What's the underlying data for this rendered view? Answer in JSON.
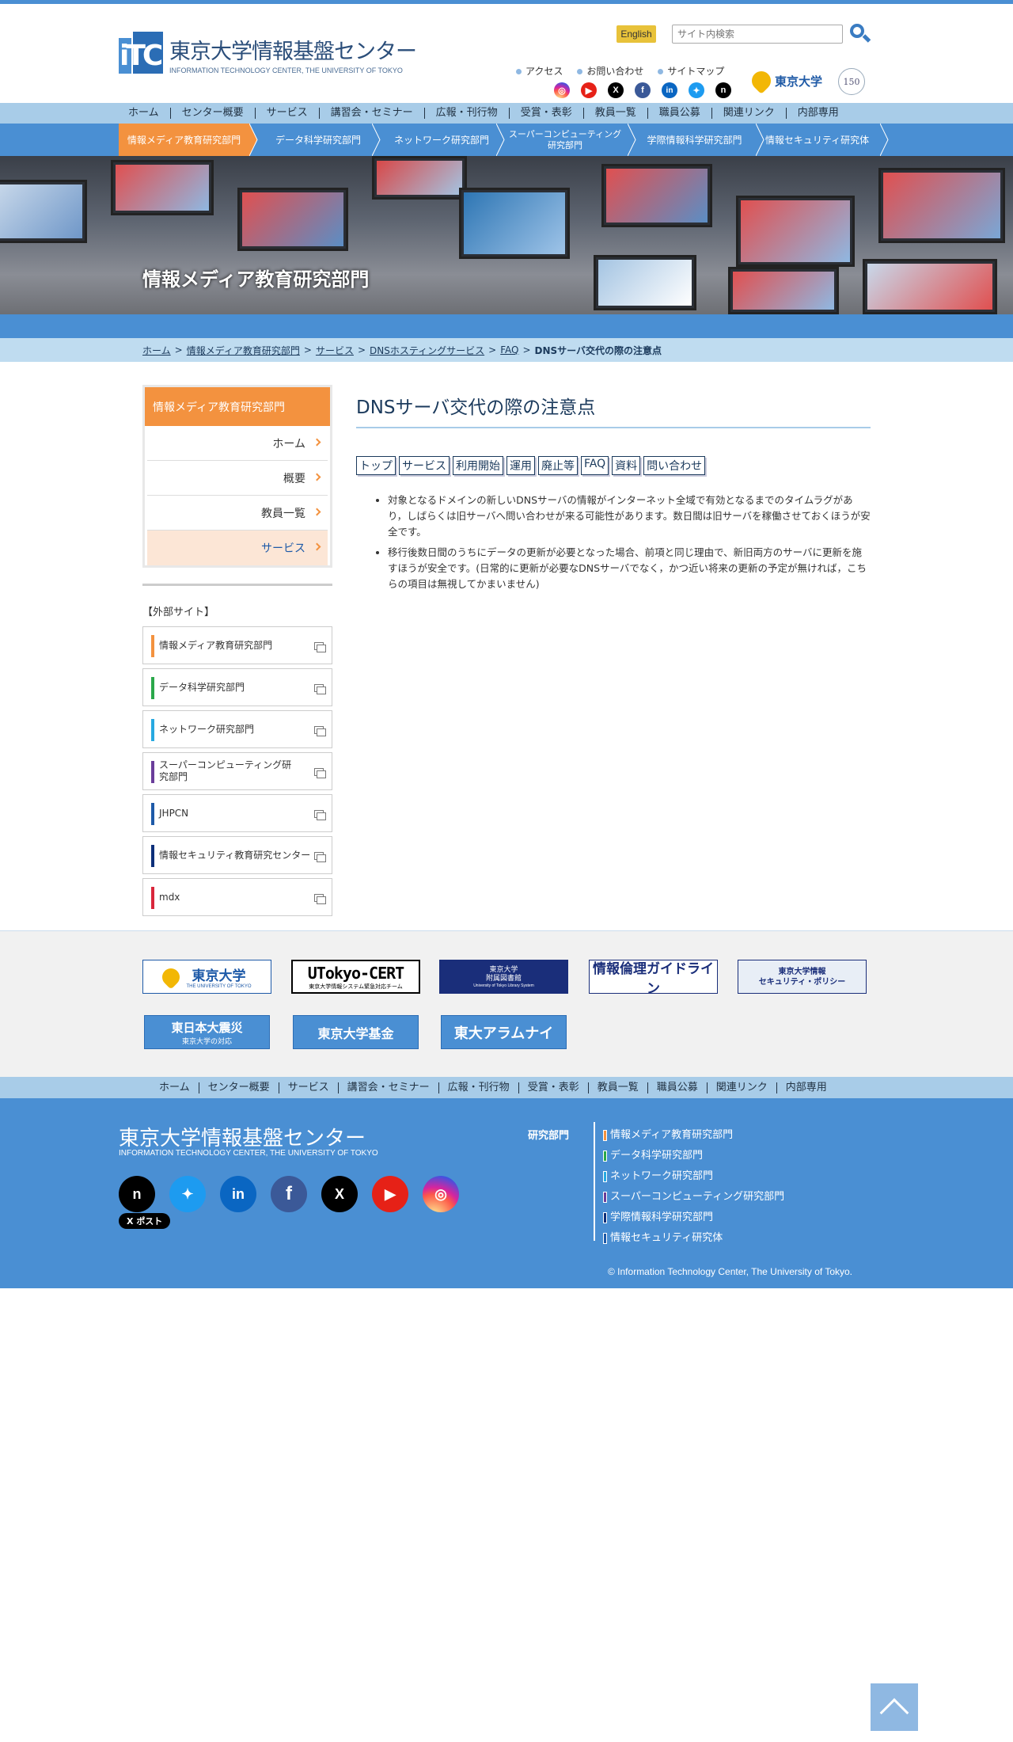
{
  "header": {
    "site_name_jp": "東京大学情報基盤センター",
    "site_name_en": "INFORMATION TECHNOLOGY CENTER, THE UNIVERSITY OF TOKYO",
    "english_label": "English",
    "search_placeholder": "サイト内検索",
    "util_links": [
      "アクセス",
      "お問い合わせ",
      "サイトマップ"
    ],
    "utokyo_label": "東京大学",
    "badge": "150"
  },
  "social_icons": [
    "instagram-icon",
    "youtube-icon",
    "x-icon",
    "facebook-icon",
    "linkedin-icon",
    "bluesky-icon",
    "note-icon"
  ],
  "global_nav": [
    "ホーム",
    "センター概要",
    "サービス",
    "講習会・セミナー",
    "広報・刊行物",
    "受賞・表彰",
    "教員一覧",
    "職員公募",
    "関連リンク",
    "内部専用"
  ],
  "dept_nav": [
    {
      "label": "情報メディア教育研究部門",
      "active": true
    },
    {
      "label": "データ科学研究部門",
      "active": false
    },
    {
      "label": "ネットワーク研究部門",
      "active": false
    },
    {
      "label": "スーパーコンピューティング研究部門",
      "active": false
    },
    {
      "label": "学際情報科学研究部門",
      "active": false
    },
    {
      "label": "情報セキュリティ研究体",
      "active": false
    }
  ],
  "hero": {
    "title": "情報メディア教育研究部門"
  },
  "breadcrumb": {
    "links": [
      "ホーム",
      "情報メディア教育研究部門",
      "サービス",
      "DNSホスティングサービス",
      "FAQ"
    ],
    "separator": ">",
    "current": "DNSサーバ交代の際の注意点"
  },
  "sidebar": {
    "title": "情報メディア教育研究部門",
    "items": [
      {
        "label": "ホーム",
        "active": false
      },
      {
        "label": "概要",
        "active": false
      },
      {
        "label": "教員一覧",
        "active": false
      },
      {
        "label": "サービス",
        "active": true
      }
    ],
    "external_label": "【外部サイト】",
    "external": [
      {
        "label": "情報メディア教育研究部門",
        "color": "#f3923f"
      },
      {
        "label": "データ科学研究部門",
        "color": "#2aa84a"
      },
      {
        "label": "ネットワーク研究部門",
        "color": "#27a9e1"
      },
      {
        "label": "スーパーコンピューティング研究部門",
        "color": "#6a3d9a"
      },
      {
        "label": "JHPCN",
        "color": "#1e5aa8"
      },
      {
        "label": "情報セキュリティ教育研究センター",
        "color": "#0d2f7a"
      },
      {
        "label": "mdx",
        "color": "#d9263b"
      }
    ]
  },
  "main": {
    "title": "DNSサーバ交代の際の注意点",
    "tabs": [
      "トップ",
      "サービス",
      "利用開始",
      "運用",
      "廃止等",
      "FAQ",
      "資料",
      "問い合わせ"
    ],
    "notes": [
      "対象となるドメインの新しいDNSサーバの情報がインターネット全域で有効となるまでのタイムラグがあり，しばらくは旧サーバへ問い合わせが来る可能性があります。数日間は旧サーバを稼働させておくほうが安全です。",
      "移行後数日間のうちにデータの更新が必要となった場合、前項と同じ理由で、新旧両方のサーバに更新を施すほうが安全です。(日常的に更新が必要なDNSサーバでなく，かつ近い将来の更新の予定が無ければ，こちらの項目は無視してかまいません)"
    ]
  },
  "banners": {
    "utokyo": "東京大学",
    "utokyo_sub": "THE UNIVERSITY OF TOKYO",
    "cert": "UTokyo-CERT",
    "cert_sub": "東京大学情報システム緊急対応チーム",
    "library": "東京大学\n附属図書館",
    "library_sub": "University of Tokyo Library System",
    "ethics": "情報倫理ガイドライン",
    "security": "東京大学情報\nセキュリティ・ポリシー",
    "quake": "東日本大震災",
    "quake_sub": "東京大学の対応",
    "fund": "東京大学基金",
    "alumni": "東大アラムナイ"
  },
  "footer_nav": [
    "ホーム",
    "センター概要",
    "サービス",
    "講習会・セミナー",
    "広報・刊行物",
    "受賞・表彰",
    "教員一覧",
    "職員公募",
    "関連リンク",
    "内部専用"
  ],
  "footer": {
    "site_name_jp": "東京大学情報基盤センター",
    "site_name_en": "INFORMATION TECHNOLOGY CENTER, THE UNIVERSITY OF TOKYO",
    "post_label": "ポスト",
    "dept_label": "研究部門",
    "depts": [
      {
        "label": "情報メディア教育研究部門",
        "color": "#f3923f"
      },
      {
        "label": "データ科学研究部門",
        "color": "#2aa84a"
      },
      {
        "label": "ネットワーク研究部門",
        "color": "#27a9e1"
      },
      {
        "label": "スーパーコンピューティング研究部門",
        "color": "#6a3d9a"
      },
      {
        "label": "学際情報科学研究部門",
        "color": "#0d2f7a"
      },
      {
        "label": "情報セキュリティ研究体",
        "color": "#1e5aa8"
      }
    ],
    "copyright": "© Information Technology Center, The University of Tokyo."
  }
}
